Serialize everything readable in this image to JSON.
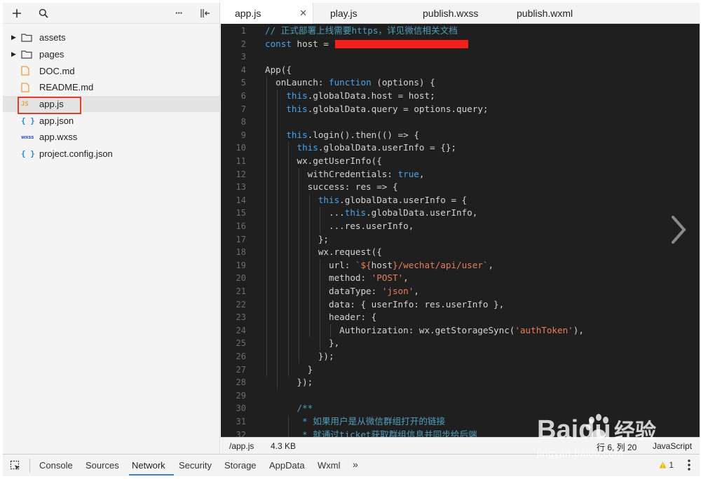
{
  "sidebar": {
    "toolbar": {
      "more_label": "···"
    },
    "tree": [
      {
        "name": "assets",
        "kind": "folder",
        "icon": "folder-icon"
      },
      {
        "name": "pages",
        "kind": "folder",
        "icon": "folder-icon"
      },
      {
        "name": "DOC.md",
        "kind": "file",
        "icon": "markdown-file-icon"
      },
      {
        "name": "README.md",
        "kind": "file",
        "icon": "markdown-file-icon"
      },
      {
        "name": "app.js",
        "kind": "file",
        "icon": "js-file-icon",
        "badge": "JS",
        "selected": true
      },
      {
        "name": "app.json",
        "kind": "file",
        "icon": "json-file-icon",
        "badge": "{ }"
      },
      {
        "name": "app.wxss",
        "kind": "file",
        "icon": "wxss-file-icon",
        "badge": "wxss"
      },
      {
        "name": "project.config.json",
        "kind": "file",
        "icon": "json-file-icon",
        "badge": "{ }"
      }
    ]
  },
  "tabs": [
    {
      "label": "app.js",
      "active": true
    },
    {
      "label": "play.js",
      "active": false
    },
    {
      "label": "publish.wxss",
      "active": false
    },
    {
      "label": "publish.wxml",
      "active": false
    }
  ],
  "editor": {
    "line_numbers": [
      "1",
      "2",
      "3",
      "4",
      "5",
      "6",
      "7",
      "8",
      "9",
      "10",
      "11",
      "12",
      "13",
      "14",
      "15",
      "16",
      "17",
      "18",
      "19",
      "20",
      "21",
      "22",
      "23",
      "24",
      "25",
      "26",
      "27",
      "28",
      "29",
      "30",
      "31",
      "32"
    ],
    "lines": [
      "// 正式部署上线需要https，详见微信相关文档",
      "const host = ",
      "",
      "App({",
      "  onLaunch: function (options) {",
      "    this.globalData.host = host;",
      "    this.globalData.query = options.query;",
      "",
      "    this.login().then(() => {",
      "      this.globalData.userInfo = {};",
      "      wx.getUserInfo({",
      "        withCredentials: true,",
      "        success: res => {",
      "          this.globalData.userInfo = {",
      "            ...this.globalData.userInfo,",
      "            ...res.userInfo,",
      "          };",
      "          wx.request({",
      "            url: `${host}/wechat/api/user`,",
      "            method: 'POST',",
      "            dataType: 'json',",
      "            data: { userInfo: res.userInfo },",
      "            header: {",
      "              Authorization: wx.getStorageSync('authToken'),",
      "            },",
      "          });",
      "        }",
      "      });",
      "",
      "      /**",
      "       * 如果用户是从微信群组打开的链接",
      "       * 就通过ticket获取群组信息并同步给后端"
    ],
    "colors": {
      "background": "#1f1f1f",
      "keyword": "#4aa3e8",
      "string": "#e97e5a",
      "comment": "#4f9fbd",
      "text": "#d4d4d4",
      "redaction": "#f2201b"
    }
  },
  "status": {
    "path": "/app.js",
    "size": "4.3 KB",
    "cursor": "行 6, 列 20",
    "language": "JavaScript"
  },
  "devtools": {
    "tabs": [
      "Console",
      "Sources",
      "Network",
      "Security",
      "Storage",
      "AppData",
      "Wxml"
    ],
    "active_tab": "Network",
    "more": "»",
    "warning_count": "1"
  },
  "watermark": {
    "brand": "Baidu",
    "cn": "经验",
    "url": "jingyan.baidu.com"
  }
}
